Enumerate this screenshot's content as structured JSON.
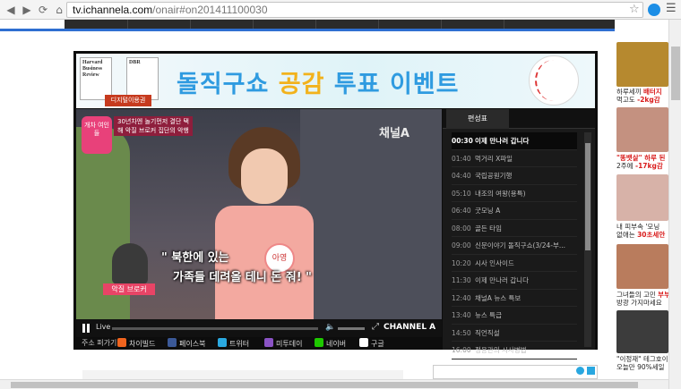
{
  "browser": {
    "url_host": "tv.ichannela.com",
    "url_path": "/onair#on201411100030"
  },
  "banner": {
    "magazine1_title": "Harvard Business Review",
    "magazine2_title": "DBR",
    "badge": "디지털이용권",
    "title_part1": "돌직구쇼",
    "title_part2": " 공감 ",
    "title_part3": "투표 이벤트"
  },
  "video": {
    "program_logo": "개차 여인들",
    "caption_top": "30년차엔 놀기먼저 결단 택해 악질 브로커 집단의 악행",
    "channel_mark": "채널A",
    "nametag": "아영",
    "subtitle_line1": "\" 북한에 있는",
    "subtitle_line2": "가족들 데려올 테니 돈 줘! \"",
    "silhouette_label": "악질 브로커"
  },
  "controls": {
    "live_label": "Live",
    "brand": "CHANNEL A"
  },
  "share": {
    "label": "주소 퍼가기",
    "items": [
      {
        "label": "차이빌드",
        "color": "#f0641e"
      },
      {
        "label": "페이스북",
        "color": "#3b5998"
      },
      {
        "label": "트위터",
        "color": "#2aa9e0"
      },
      {
        "label": "미투데이",
        "color": "#8a53c4"
      },
      {
        "label": "네이버",
        "color": "#1ec800"
      },
      {
        "label": "구글",
        "color": "#ffffff"
      }
    ]
  },
  "schedule": {
    "tab_label": "편성표",
    "rows": [
      {
        "time": "00:30",
        "title": "이제 만나러 갑니다",
        "active": true
      },
      {
        "time": "01:40",
        "title": "먹거리 X파일",
        "active": false
      },
      {
        "time": "04:40",
        "title": "국립공원기행",
        "active": false
      },
      {
        "time": "05:10",
        "title": "내조의 여왕(용특)",
        "active": false
      },
      {
        "time": "06:40",
        "title": "굿모닝 A",
        "active": false
      },
      {
        "time": "08:00",
        "title": "골든 타임",
        "active": false
      },
      {
        "time": "09:00",
        "title": "신문이야기 돌직구쇼(3/24-부...",
        "active": false
      },
      {
        "time": "10:20",
        "title": "시사 인사이드",
        "active": false
      },
      {
        "time": "11:30",
        "title": "이제 만나러 갑니다",
        "active": false
      },
      {
        "time": "12:40",
        "title": "채널A 뉴스 특보",
        "active": false
      },
      {
        "time": "13:40",
        "title": "뉴스 특급",
        "active": false
      },
      {
        "time": "14:50",
        "title": "직언직설",
        "active": false
      },
      {
        "time": "16:00",
        "title": "정용관의 시사병법",
        "active": false
      }
    ]
  },
  "ads": [
    {
      "line1_a": "하루세끼 ",
      "line1_b": "배터지",
      "line2_a": "먹고도 ",
      "line2_b": "-2kg감",
      "color": "#b6892f"
    },
    {
      "line1_a": "\"똥뱃살\" 하루 된",
      "line1_b": "",
      "line2_a": "2주에 ",
      "line2_b": "-17kg감",
      "color": "#c49180"
    },
    {
      "line1_a": "내 피부속 '모닝",
      "line1_b": "",
      "line2_a": "없애는 ",
      "line2_b": "30초세안",
      "color": "#d7b2a8"
    },
    {
      "line1_a": "그녀들의 고민 ",
      "line1_b": "부부",
      "line2_a": "방광 가지마세요",
      "line2_b": "",
      "color": "#b97c5d"
    },
    {
      "line1_a": "\"이정재\" 테그호이",
      "line1_b": "",
      "line2_a": "오늘만 90%세일",
      "line2_b": "",
      "color": "#3c3c3c"
    }
  ]
}
